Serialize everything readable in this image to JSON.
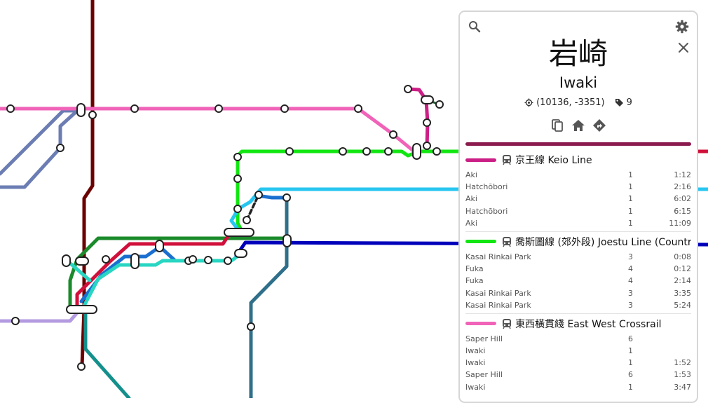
{
  "map": {
    "colors": {
      "dark_red": "#6b0000",
      "pink": "#f063b8",
      "slate": "#6b7db3",
      "green": "#12e612",
      "cyan": "#26c6f0",
      "blue": "#0000bb",
      "teal_dark": "#2f6f8a",
      "forest": "#1a8a2a",
      "crimson": "#d0103a",
      "mid_blue": "#1a6fd0",
      "aqua": "#28d6c2",
      "lavender": "#b49be0",
      "teal": "#14908c",
      "magenta": "#cc1f86"
    }
  },
  "panel": {
    "search_icon": "search-icon",
    "settings_icon": "gear-icon",
    "close_icon": "close-icon",
    "station_name_cjk": "岩崎",
    "station_name_en": "Iwaki",
    "coordinates": "(10136, -3351)",
    "tag_count": "9",
    "action_icons": [
      "copy-icon",
      "home-icon",
      "directions-icon"
    ],
    "accent_color": "#8b1a4e",
    "routes": [
      {
        "name": "京王線 Keio Line",
        "color": "#cc1f86",
        "departures": [
          {
            "dest": "Aki",
            "platform": "1",
            "time": "1:12"
          },
          {
            "dest": "Hatchōbori",
            "platform": "1",
            "time": "2:16"
          },
          {
            "dest": "Aki",
            "platform": "1",
            "time": "6:02"
          },
          {
            "dest": "Hatchōbori",
            "platform": "1",
            "time": "6:15"
          },
          {
            "dest": "Aki",
            "platform": "1",
            "time": "11:09"
          }
        ]
      },
      {
        "name": "喬斯圖線 (郊外段) Joestu Line (Countryside)",
        "color": "#12e612",
        "departures": [
          {
            "dest": "Kasai Rinkai Park",
            "platform": "3",
            "time": "0:08"
          },
          {
            "dest": "Fuka",
            "platform": "4",
            "time": "0:12"
          },
          {
            "dest": "Fuka",
            "platform": "4",
            "time": "2:14"
          },
          {
            "dest": "Kasai Rinkai Park",
            "platform": "3",
            "time": "3:35"
          },
          {
            "dest": "Kasai Rinkai Park",
            "platform": "3",
            "time": "5:24"
          }
        ]
      },
      {
        "name": "東西橫貫綫 East West Crossrail",
        "color": "#f063b8",
        "departures": [
          {
            "dest": "Saper Hill",
            "platform": "6",
            "time": ""
          },
          {
            "dest": "Iwaki",
            "platform": "1",
            "time": ""
          },
          {
            "dest": "Iwaki",
            "platform": "1",
            "time": "1:52"
          },
          {
            "dest": "Saper Hill",
            "platform": "6",
            "time": "1:53"
          },
          {
            "dest": "Iwaki",
            "platform": "1",
            "time": "3:47"
          }
        ]
      }
    ]
  }
}
